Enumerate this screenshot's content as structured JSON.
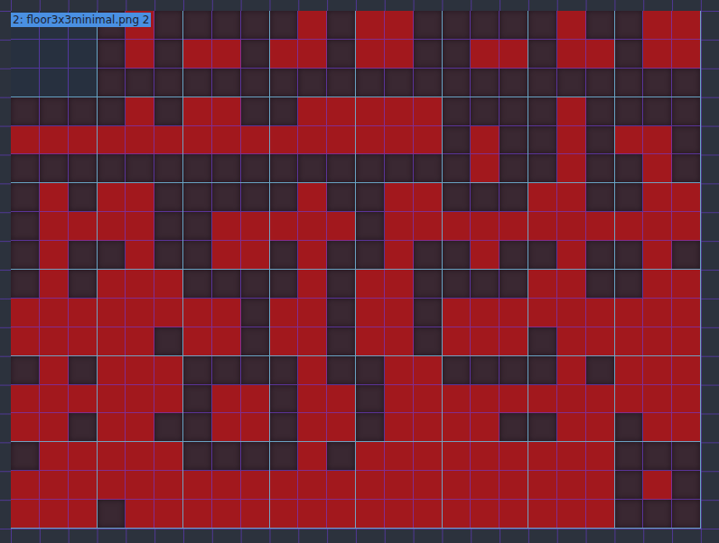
{
  "label": "2: floor3x3minimal.png 2",
  "tiles": [
    {
      "mask": "000000000",
      "empty": true
    },
    {
      "mask": "010010000",
      "empty": false
    },
    {
      "mask": "000110000",
      "empty": false
    },
    {
      "mask": "010110000",
      "empty": false
    },
    {
      "mask": "110110000",
      "empty": false
    },
    {
      "mask": "000011000",
      "empty": false
    },
    {
      "mask": "010011000",
      "empty": false
    },
    {
      "mask": "011011000",
      "empty": false
    },
    {
      "mask": "000111000",
      "empty": false
    },
    {
      "mask": "010111000",
      "empty": false
    },
    {
      "mask": "110111000",
      "empty": false
    },
    {
      "mask": "011111000",
      "empty": false
    },
    {
      "mask": "111111000",
      "empty": false
    },
    {
      "mask": "000010010",
      "empty": false
    },
    {
      "mask": "010010010",
      "empty": false
    },
    {
      "mask": "000110010",
      "empty": false
    },
    {
      "mask": "010011010",
      "empty": false
    },
    {
      "mask": "110110010",
      "empty": false
    },
    {
      "mask": "000011011",
      "empty": false
    },
    {
      "mask": "010111010",
      "empty": false
    },
    {
      "mask": "011011010",
      "empty": false
    },
    {
      "mask": "000111010",
      "empty": false
    },
    {
      "mask": "110111010",
      "empty": false
    },
    {
      "mask": "011111010",
      "empty": false
    },
    {
      "mask": "010111111",
      "empty": false
    },
    {
      "mask": "111111110",
      "empty": false
    },
    {
      "mask": "000110110",
      "empty": false
    },
    {
      "mask": "010110110",
      "empty": false
    },
    {
      "mask": "110110110",
      "empty": false
    },
    {
      "mask": "000111111",
      "empty": false
    },
    {
      "mask": "110111011",
      "empty": false
    },
    {
      "mask": "011111111",
      "empty": false
    },
    {
      "mask": "010111110",
      "empty": false
    },
    {
      "mask": "111111110",
      "empty": false
    },
    {
      "mask": "000011011",
      "empty": false
    },
    {
      "mask": "010011011",
      "empty": false
    },
    {
      "mask": "011011011",
      "empty": false
    },
    {
      "mask": "000111110",
      "empty": false
    },
    {
      "mask": "010111011",
      "empty": false
    },
    {
      "mask": "111111011",
      "empty": false
    },
    {
      "mask": "011111111",
      "empty": false
    },
    {
      "mask": "111111011",
      "empty": false
    },
    {
      "mask": "000111111",
      "empty": false
    },
    {
      "mask": "010111111",
      "empty": false
    },
    {
      "mask": "111111111",
      "empty": false
    },
    {
      "mask": "111111111",
      "empty": false
    },
    {
      "mask": "111111111",
      "empty": false
    },
    {
      "mask": "000010000",
      "empty": false
    }
  ]
}
